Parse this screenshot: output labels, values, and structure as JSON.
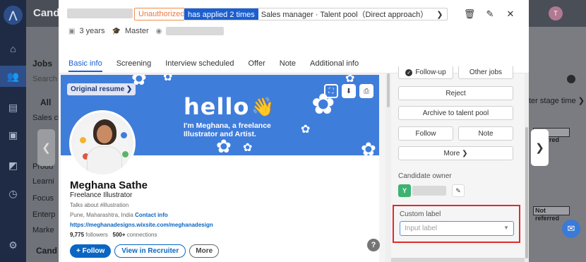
{
  "app": {
    "brand": "Candi",
    "sidebar": {
      "jobs": "Jobs",
      "search_partial": "Search",
      "all": "All",
      "items": [
        "Sales ci",
        "Produ",
        "Learni",
        "Focus",
        "Enterp",
        "Marke"
      ],
      "candidates": "Cand"
    },
    "avatar_initial": "T",
    "stage_time_text": "ter stage time ❯",
    "not_referred_labels": [
      "Not referred",
      "Not referred"
    ]
  },
  "modal": {
    "header": {
      "status_badge": "Unauthorized",
      "applied_count": "has applied 2 times",
      "applied_job": "Sales manager · Talent pool（Direct approach）",
      "experience": "3 years",
      "education": "Master"
    },
    "tabs": [
      {
        "label": "Basic info",
        "active": true
      },
      {
        "label": "Screening",
        "active": false
      },
      {
        "label": "Interview scheduled",
        "active": false
      },
      {
        "label": "Offer",
        "active": false
      },
      {
        "label": "Note",
        "active": false
      },
      {
        "label": "Additional info",
        "active": false
      }
    ],
    "resume": {
      "original_resume_btn": "Original resume ❯",
      "banner_hello": "hello",
      "banner_tagline": "I'm Meghana, a freelance Illustrator and Artist.",
      "name": "Meghana Sathe",
      "headline": "Freelance Illustrator",
      "talks_about": "Talks about #illustration",
      "location": "Pune, Maharashtra, India",
      "contact_info": "Contact info",
      "website": "https://meghanadesigns.wixsite.com/meghanadesign",
      "followers_count": "9,775",
      "followers_label": "followers",
      "connections_count": "500+",
      "connections_label": "connections",
      "follow_btn": "+ Follow",
      "recruiter_btn": "View in Recruiter",
      "more_btn": "More"
    },
    "help": "?",
    "actions": {
      "follow_up": "Follow-up",
      "other_jobs": "Other jobs",
      "reject": "Reject",
      "archive": "Archive to talent pool",
      "follow": "Follow",
      "note": "Note",
      "more": "More ❯"
    },
    "owner": {
      "label": "Candidate owner",
      "avatar_initial": "Y"
    },
    "custom_label": {
      "label": "Custom label",
      "placeholder": "Input label"
    }
  },
  "colors": {
    "primary": "#1b5fd0",
    "unauthorized": "#f0753a",
    "highlight_border": "#e02a2a",
    "linkedin_blue": "#0a66c2",
    "banner_blue": "#3f7ddb"
  }
}
